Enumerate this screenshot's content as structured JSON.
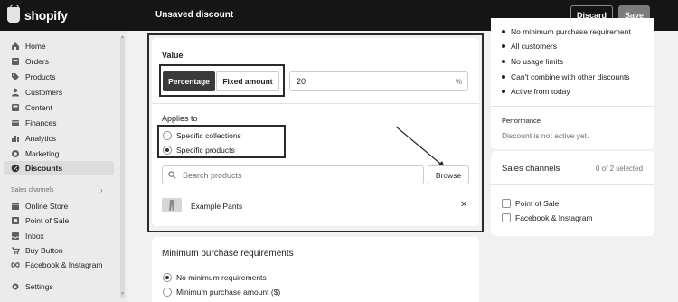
{
  "topbar": {
    "brand": "shopify",
    "page_title": "Unsaved discount",
    "discard_label": "Discard",
    "save_label": "Save"
  },
  "sidebar": {
    "items": [
      {
        "label": "Home",
        "icon": "home-icon"
      },
      {
        "label": "Orders",
        "icon": "orders-icon"
      },
      {
        "label": "Products",
        "icon": "tag-icon"
      },
      {
        "label": "Customers",
        "icon": "person-icon"
      },
      {
        "label": "Content",
        "icon": "content-icon"
      },
      {
        "label": "Finances",
        "icon": "finances-icon"
      },
      {
        "label": "Analytics",
        "icon": "analytics-icon"
      },
      {
        "label": "Marketing",
        "icon": "marketing-icon"
      },
      {
        "label": "Discounts",
        "icon": "discount-icon",
        "active": true
      }
    ],
    "channels_label": "Sales channels",
    "channels": [
      {
        "label": "Online Store",
        "icon": "store-icon"
      },
      {
        "label": "Point of Sale",
        "icon": "pos-icon"
      },
      {
        "label": "Inbox",
        "icon": "inbox-icon"
      },
      {
        "label": "Buy Button",
        "icon": "buy-button-icon"
      },
      {
        "label": "Facebook & Instagram",
        "icon": "facebook-icon"
      }
    ],
    "settings_label": "Settings"
  },
  "value_card": {
    "title": "Value",
    "percentage_label": "Percentage",
    "fixed_label": "Fixed amount",
    "value_input": "20",
    "value_suffix": "%",
    "applies_to_title": "Applies to",
    "applies_options": [
      "Specific collections",
      "Specific products"
    ],
    "applies_selected": 1,
    "search_placeholder": "Search products",
    "browse_label": "Browse",
    "product_name": "Example Pants"
  },
  "min_card": {
    "title": "Minimum purchase requirements",
    "options": [
      "No minimum requirements",
      "Minimum purchase amount ($)"
    ],
    "selected": 0
  },
  "summary": {
    "details": [
      "No minimum purchase requirement",
      "All customers",
      "No usage limits",
      "Can't combine with other discounts",
      "Active from today"
    ],
    "performance_title": "Performance",
    "performance_text": "Discount is not active yet."
  },
  "channels_card": {
    "title": "Sales channels",
    "count": "0 of 2 selected",
    "options": [
      "Point of Sale",
      "Facebook & Instagram"
    ]
  }
}
